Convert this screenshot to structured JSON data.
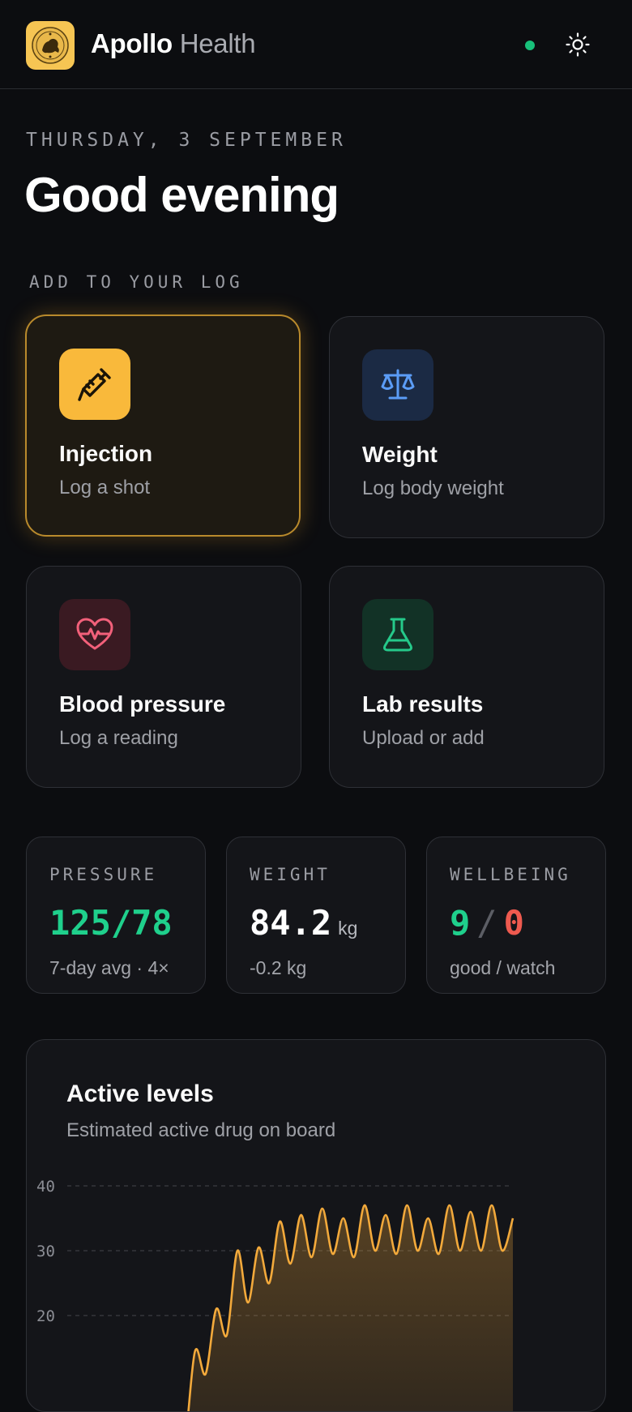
{
  "header": {
    "brand_primary": "Apollo",
    "brand_secondary": "Health",
    "logo_icon": "seal-logo-icon",
    "status_color": "#18c07a",
    "theme_toggle_icon": "sun-icon"
  },
  "date": "THURSDAY, 3 SEPTEMBER",
  "greeting": "Good evening",
  "log_section_label": "ADD TO YOUR LOG",
  "log_actions": [
    {
      "title": "Injection",
      "subtitle": "Log a shot",
      "icon": "syringe-icon",
      "accent": "#f9b93b"
    },
    {
      "title": "Weight",
      "subtitle": "Log body weight",
      "icon": "scale-icon",
      "accent": "#5b9cf6"
    },
    {
      "title": "Blood pressure",
      "subtitle": "Log a reading",
      "icon": "heart-pulse-icon",
      "accent": "#f2607a"
    },
    {
      "title": "Lab results",
      "subtitle": "Upload or add",
      "icon": "flask-icon",
      "accent": "#25c98a"
    }
  ],
  "stats": {
    "pressure": {
      "label": "PRESSURE",
      "value": "125/78",
      "sub": "7-day avg · 4×",
      "color": "#1fd08c"
    },
    "weight": {
      "label": "WEIGHT",
      "value": "84.2",
      "unit": "kg",
      "sub": "-0.2 kg"
    },
    "wellbeing": {
      "label": "WELLBEING",
      "good": "9",
      "separator": "/",
      "watch": "0",
      "sub": "good / watch",
      "good_color": "#1fd08c",
      "watch_color": "#ee5a4f"
    }
  },
  "chart": {
    "title": "Active levels",
    "subtitle": "Estimated active drug on board"
  },
  "chart_data": {
    "type": "area",
    "title": "Active levels",
    "subtitle": "Estimated active drug on board",
    "y_ticks": [
      40,
      30,
      20
    ],
    "ylim": [
      0,
      40
    ],
    "grid": true,
    "color": "#f2a93b",
    "series": [
      {
        "values": [
          [
            0,
            0
          ],
          [
            1,
            0
          ],
          [
            2,
            0
          ],
          [
            3,
            0
          ],
          [
            4,
            0
          ],
          [
            5,
            0
          ],
          [
            6,
            0
          ],
          [
            7,
            0
          ],
          [
            8,
            0
          ],
          [
            9,
            14.5
          ],
          [
            10,
            11
          ],
          [
            11,
            21
          ],
          [
            12,
            17
          ],
          [
            13,
            30
          ],
          [
            14,
            22
          ],
          [
            15,
            30.5
          ],
          [
            16,
            25
          ],
          [
            17,
            34.5
          ],
          [
            18,
            28
          ],
          [
            19,
            35.5
          ],
          [
            20,
            29
          ],
          [
            21,
            36.5
          ],
          [
            22,
            29.5
          ],
          [
            23,
            35
          ],
          [
            24,
            29
          ],
          [
            25,
            37
          ],
          [
            26,
            30
          ],
          [
            27,
            35.5
          ],
          [
            28,
            29.5
          ],
          [
            29,
            37
          ],
          [
            30,
            30
          ],
          [
            31,
            35
          ],
          [
            32,
            29.5
          ],
          [
            33,
            37
          ],
          [
            34,
            30
          ],
          [
            35,
            36
          ],
          [
            36,
            30
          ],
          [
            37,
            37
          ],
          [
            38,
            30
          ],
          [
            39,
            35
          ]
        ]
      }
    ]
  }
}
